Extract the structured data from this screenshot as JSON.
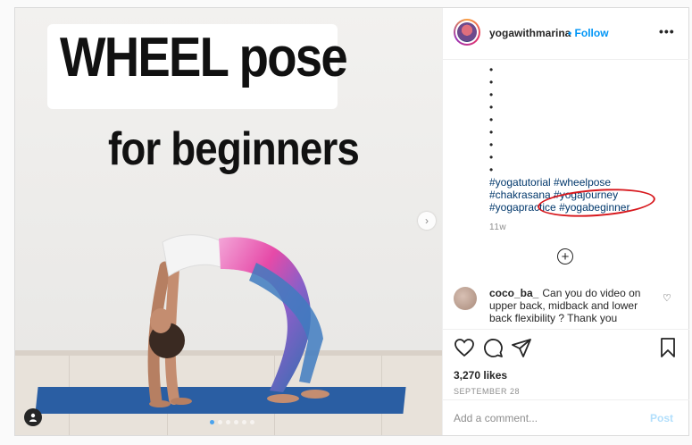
{
  "media": {
    "title_line1": "WHEEL pose",
    "title_line2": "for beginners",
    "next_icon": "chevron-right-icon",
    "tag_icon": "user-tag-icon",
    "carousel": {
      "count": 6,
      "active_index": 0
    }
  },
  "header": {
    "username": "yogawithmarina",
    "separator": "•",
    "follow_label": "Follow",
    "more_label": "•••"
  },
  "caption": {
    "bullets": [
      "•",
      "•",
      "•",
      "•",
      "•",
      "•",
      "•",
      "•",
      "•"
    ],
    "tags_line1": "#yogatutorial #wheelpose",
    "tags_line2": "#chakrasana #yogajourney",
    "tags_line3a": "#yogapractice",
    "tags_line3b": "#yogabeginner",
    "age": "11w"
  },
  "load_more_label": "+",
  "comment": {
    "username": "coco_ba_",
    "text": "Can you do video on upper back, midback and lower back flexibility ? Thank you"
  },
  "actions": {
    "likes": "3,270 likes",
    "date": "SEPTEMBER 28"
  },
  "add_comment": {
    "placeholder": "Add a comment...",
    "post_label": "Post"
  },
  "colors": {
    "link_blue": "#0095f6",
    "hashtag": "#00376b",
    "annotation_red": "#d7171c"
  }
}
